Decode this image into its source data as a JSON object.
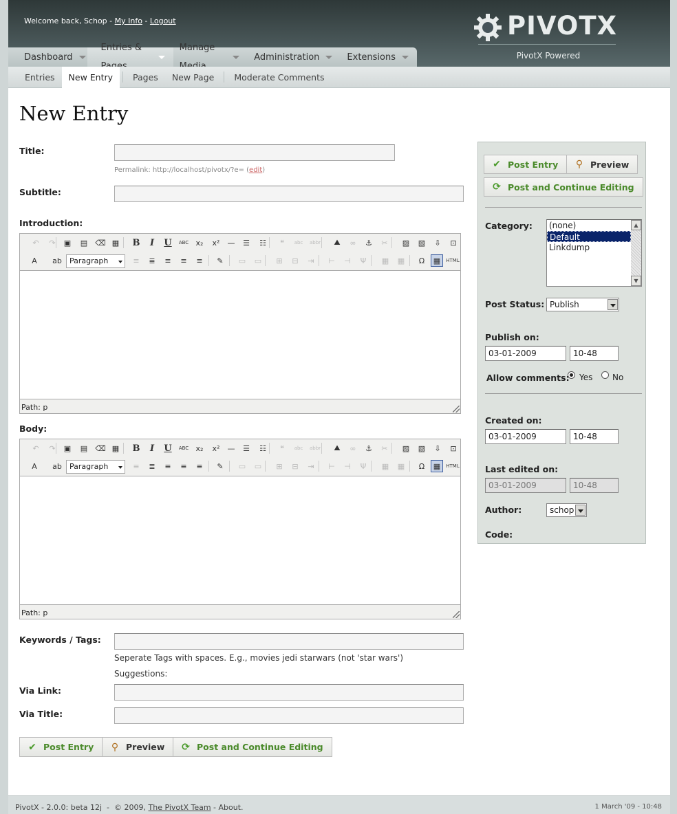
{
  "header": {
    "welcome_prefix": "Welcome back, Schop - ",
    "my_info": "My Info",
    "separator": " - ",
    "logout": "Logout",
    "logo_text": "PIVOTX",
    "logo_sub": "PivotX Powered"
  },
  "mainnav": [
    "Dashboard",
    "Entries & Pages",
    "Manage Media",
    "Administration",
    "Extensions"
  ],
  "subnav": [
    "Entries",
    "New Entry",
    "Pages",
    "New Page",
    "Moderate Comments"
  ],
  "page_title": "New Entry",
  "form": {
    "title_label": "Title:",
    "title_value": "",
    "permalink_prefix": "Permalink: http://localhost/pivotx/?e= (",
    "permalink_edit": "edit",
    "permalink_suffix": ")",
    "subtitle_label": "Subtitle:",
    "introduction_label": "Introduction:",
    "body_label": "Body:",
    "format_value": "Paragraph",
    "path_text": "Path: p",
    "keywords_label": "Keywords / Tags:",
    "tags_hint": "Seperate Tags with spaces. E.g., movies jedi starwars (not 'star wars')",
    "suggestions": "Suggestions:",
    "via_link_label": "Via Link:",
    "via_title_label": "Via Title:"
  },
  "buttons": {
    "post_entry": "Post Entry",
    "preview": "Preview",
    "post_continue": "Post and Continue Editing"
  },
  "sidebar": {
    "category_label": "Category:",
    "categories": [
      "(none)",
      "Default",
      "Linkdump"
    ],
    "selected_category": "Default",
    "post_status_label": "Post Status:",
    "post_status": "Publish",
    "publish_on_label": "Publish on:",
    "publish_date": "03-01-2009",
    "publish_time": "10-48",
    "allow_comments_label": "Allow comments:",
    "yes": "Yes",
    "no": "No",
    "created_on_label": "Created on:",
    "created_date": "03-01-2009",
    "created_time": "10-48",
    "last_edited_label": "Last edited on:",
    "edited_date": "03-01-2009",
    "edited_time": "10-48",
    "author_label": "Author:",
    "author": "schop",
    "code_label": "Code:"
  },
  "footer": {
    "version": "PivotX - 2.0.0: beta 12j",
    "dash": "  -  ",
    "copyright": "© 2009, ",
    "team": "The PivotX Team",
    "about": " - About.",
    "datetime": "1 March '09 - 10:48"
  }
}
